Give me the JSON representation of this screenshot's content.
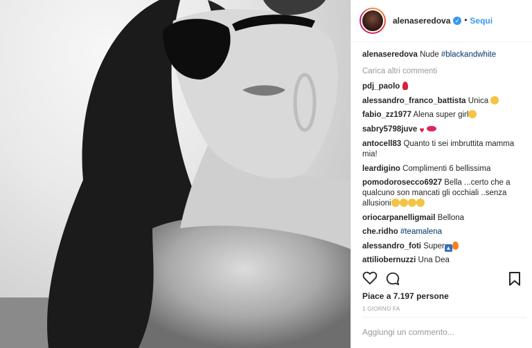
{
  "post": {
    "username": "alenaseredova",
    "follow_label": "Sequi",
    "separator": "•",
    "verified_icon": "verified-badge-icon"
  },
  "caption": {
    "user": "alenaseredova",
    "text": "Nude ",
    "hashtag": "#blackandwhite"
  },
  "load_more": "Carica altri commenti",
  "comments": [
    {
      "user": "pdj_paolo",
      "text": "",
      "emoji": [
        "rose"
      ]
    },
    {
      "user": "alessandro_franco_battista",
      "text": "Unica",
      "emoji": [
        "hugging-face"
      ]
    },
    {
      "user": "fabio_zz1977",
      "text": "Alena super girl",
      "emoji": [
        "heart-eyes"
      ]
    },
    {
      "user": "sabry5798juve",
      "text": "",
      "emoji": [
        "broken-heart",
        "kiss-lips"
      ]
    },
    {
      "user": "antocell83",
      "text": "Quanto ti sei imbruttita mamma mia!"
    },
    {
      "user": "leardigino",
      "text": "Complimenti 6 bellissima"
    },
    {
      "user": "pomodorosecco6927",
      "text": "Bella ...certo che a qualcuno son mancati gli occhiali ..senza allusioni",
      "emoji": [
        "grin",
        "grin",
        "grin",
        "grin"
      ]
    },
    {
      "user": "oriocarpanelligmail",
      "text": "Bellona"
    },
    {
      "user": "che.ridho",
      "text": "",
      "hashtag": "#teamalena"
    },
    {
      "user": "alessandro_foti",
      "text": "Super",
      "emoji": [
        "up-arrow",
        "fire"
      ]
    },
    {
      "user": "attiliobernuzzi",
      "text": "Una Dea"
    }
  ],
  "actions": {
    "like": "heart-outline-icon",
    "comment": "comment-bubble-icon",
    "save": "bookmark-icon"
  },
  "likes_text": "Piace a 7.197 persone",
  "timestamp": "1 GIORNO FA",
  "add_comment_placeholder": "Aggiungi un commento...",
  "colors": {
    "link": "#3897f0",
    "hashtag": "#003569",
    "muted": "#999999",
    "text": "#262626"
  }
}
